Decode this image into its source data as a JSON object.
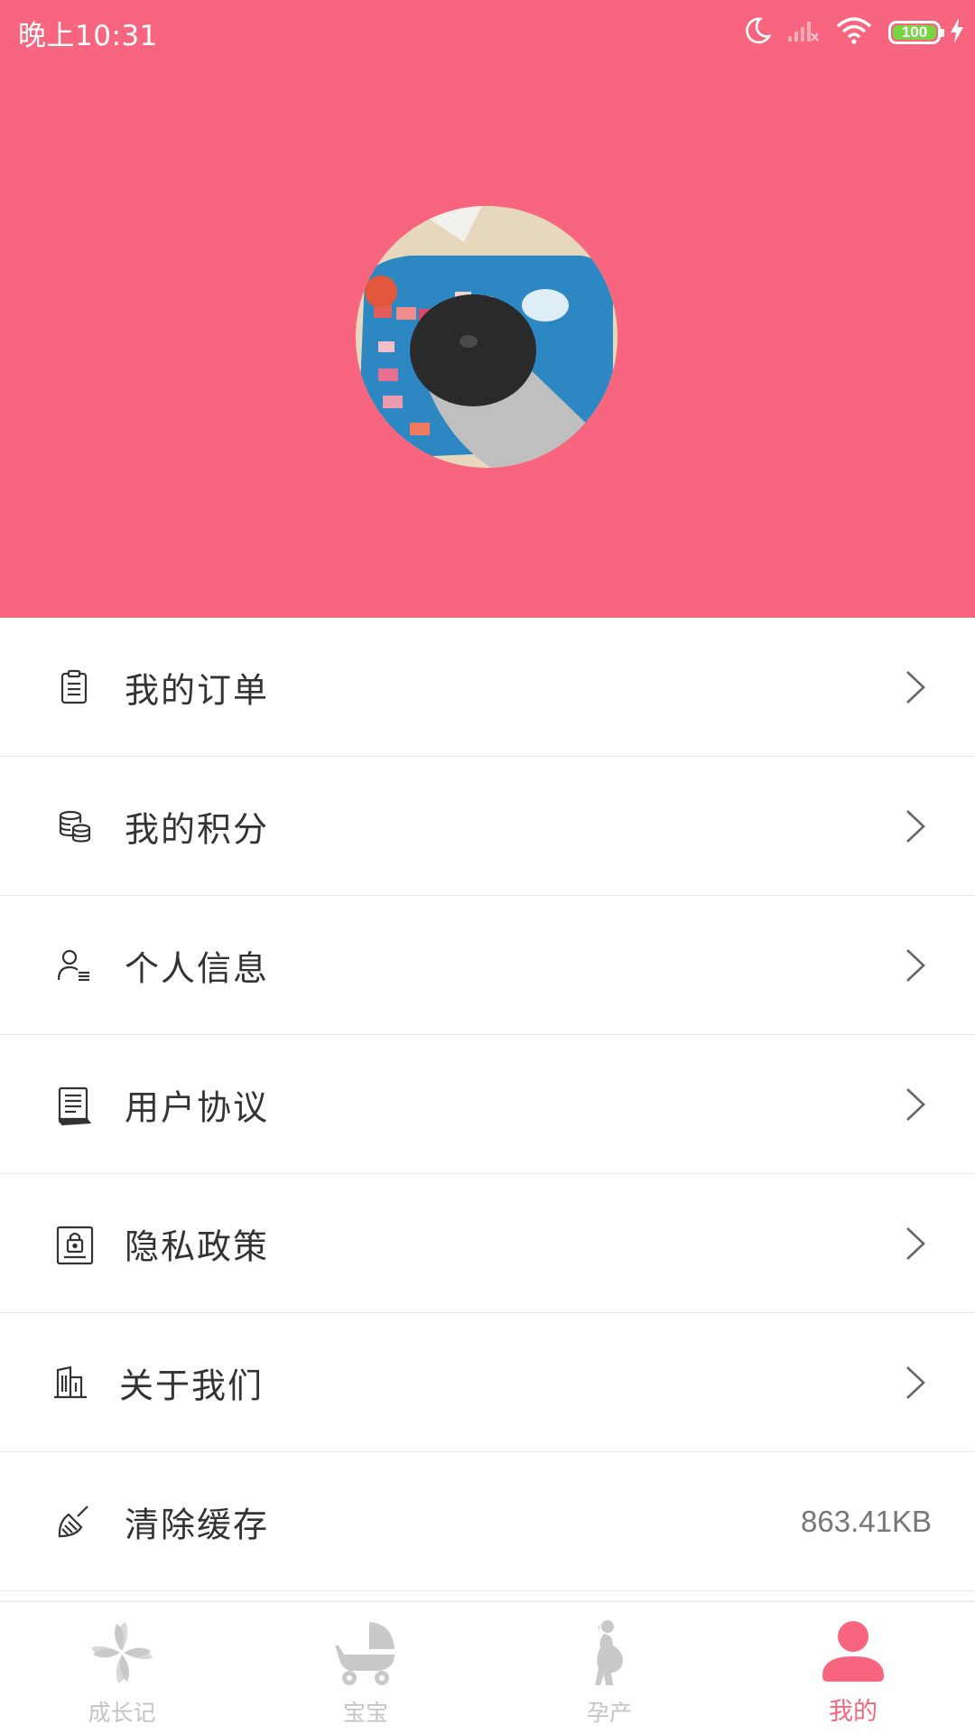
{
  "status_bar": {
    "time": "晚上10:31",
    "battery": "100"
  },
  "colors": {
    "accent": "#f7667e",
    "inactive": "#c4c4c4",
    "battery_green": "#76d644"
  },
  "menu": [
    {
      "label": "我的订单",
      "icon": "clipboard-icon"
    },
    {
      "label": "我的积分",
      "icon": "coins-icon"
    },
    {
      "label": "个人信息",
      "icon": "user-info-icon"
    },
    {
      "label": "用户协议",
      "icon": "document-icon"
    },
    {
      "label": "隐私政策",
      "icon": "lock-document-icon"
    },
    {
      "label": "关于我们",
      "icon": "building-icon"
    },
    {
      "label": "清除缓存",
      "icon": "broom-icon",
      "value": "863.41KB"
    }
  ],
  "tabs": [
    {
      "label": "成长记",
      "icon": "pinwheel-icon",
      "active": false
    },
    {
      "label": "宝宝",
      "icon": "stroller-icon",
      "active": false
    },
    {
      "label": "孕产",
      "icon": "pregnant-icon",
      "active": false
    },
    {
      "label": "我的",
      "icon": "person-icon",
      "active": true
    }
  ]
}
